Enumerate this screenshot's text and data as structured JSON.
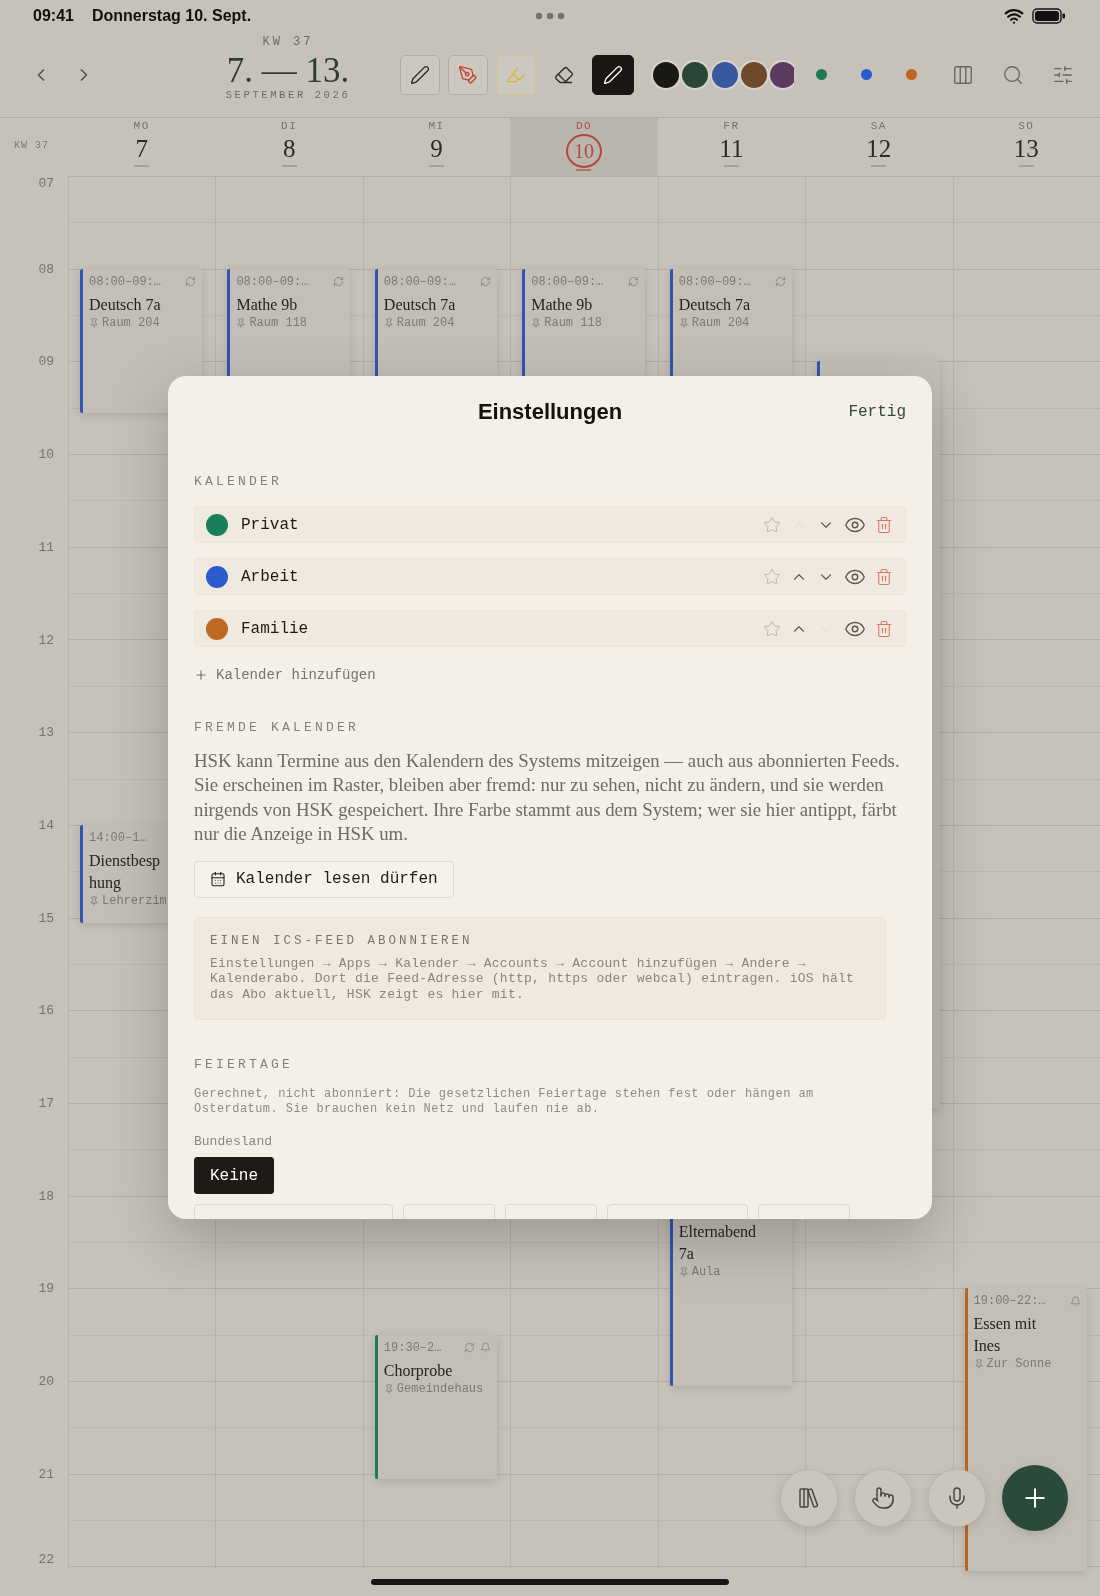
{
  "status_bar": {
    "time": "09:41",
    "date": "Donnerstag 10. Sept."
  },
  "toolbar": {
    "week": "KW 37",
    "range": "7. — 13.",
    "month": "SEPTEMBER 2026",
    "tools": [
      {
        "kind": "pen",
        "selected": false
      },
      {
        "kind": "marker",
        "selected": false
      },
      {
        "kind": "highlighter",
        "selected": false
      },
      {
        "kind": "eraser",
        "selected": false
      },
      {
        "kind": "pen",
        "selected": true
      }
    ],
    "swatches": [
      {
        "color": "#1b1917"
      },
      {
        "color": "#2b4537"
      },
      {
        "color": "#3a58a0"
      },
      {
        "color": "#6e4a2d"
      },
      {
        "color": "#5b3a60"
      }
    ],
    "calendar_dots": [
      {
        "color": "#1d7a55"
      },
      {
        "color": "#2c5bd0"
      },
      {
        "color": "#c0661f"
      }
    ]
  },
  "week_label": "KW 37",
  "days": [
    {
      "name": "MO",
      "number": "7",
      "selected": false,
      "events": [
        {
          "kind": "lesson",
          "time": "08:00–09:…",
          "title": "Deutsch 7a",
          "location": "Raum 204",
          "color": "#2f57b0",
          "recurring": true,
          "reminder": false
        },
        {
          "kind": "meeting",
          "time": "14:00–1…",
          "title": "Dienstbesp hung",
          "location": "Lehrerzim",
          "color": "#2f57b0",
          "recurring": false,
          "reminder": false
        }
      ]
    },
    {
      "name": "DI",
      "number": "8",
      "selected": false,
      "events": [
        {
          "kind": "lesson",
          "time": "08:00–09:…",
          "title": "Mathe 9b",
          "location": "Raum 118",
          "color": "#2f57b0",
          "recurring": true,
          "reminder": false
        }
      ]
    },
    {
      "name": "MI",
      "number": "9",
      "selected": false,
      "events": [
        {
          "kind": "lesson",
          "time": "08:00–09:…",
          "title": "Deutsch 7a",
          "location": "Raum 204",
          "color": "#2f57b0",
          "recurring": true,
          "reminder": false
        },
        {
          "kind": "rehearsal",
          "time": "19:30–2…",
          "title": "Chorprobe",
          "location": "Gemeindehaus",
          "color": "#1f7a52",
          "recurring": true,
          "reminder": true
        }
      ]
    },
    {
      "name": "DO",
      "number": "10",
      "selected": true,
      "events": [
        {
          "kind": "lesson",
          "time": "08:00–09:…",
          "title": "Mathe 9b",
          "location": "Raum 118",
          "color": "#2f57b0",
          "recurring": true,
          "reminder": false
        }
      ]
    },
    {
      "name": "FR",
      "number": "11",
      "selected": false,
      "events": [
        {
          "kind": "lesson",
          "time": "08:00–09:…",
          "title": "Deutsch 7a",
          "location": "Raum 204",
          "color": "#2f57b0",
          "recurring": true,
          "reminder": false
        },
        {
          "kind": "parents",
          "title": "Elternabend 7a",
          "location": "Aula",
          "color": "#2f57b0"
        }
      ]
    },
    {
      "name": "SA",
      "number": "12",
      "selected": false,
      "events": [
        {
          "kind": "workday",
          "color": "#2f57b0"
        }
      ]
    },
    {
      "name": "SO",
      "number": "13",
      "selected": false,
      "events": [
        {
          "kind": "dinner",
          "time": "19:00–22:…",
          "title": "Essen mit Ines",
          "location": "Zur Sonne",
          "color": "#b8651f",
          "recurring": false,
          "reminder": true
        }
      ]
    }
  ],
  "hours": [
    "07",
    "08",
    "09",
    "10",
    "11",
    "12",
    "13",
    "14",
    "15",
    "16",
    "17",
    "18",
    "19",
    "20",
    "21",
    "22"
  ],
  "settings": {
    "title": "Einstellungen",
    "done": "Fertig",
    "calendars_heading": "KALENDER",
    "calendars": [
      {
        "name": "Privat",
        "color": "#1a7f5a",
        "favorite": false,
        "visible": true,
        "up_disabled": true,
        "down_disabled": false
      },
      {
        "name": "Arbeit",
        "color": "#2c5bd0",
        "favorite": false,
        "visible": true,
        "up_disabled": false,
        "down_disabled": false
      },
      {
        "name": "Familie",
        "color": "#bf6a22",
        "favorite": false,
        "visible": true,
        "up_disabled": false,
        "down_disabled": true
      }
    ],
    "add_calendar": "Kalender hinzufügen",
    "external_heading": "FREMDE KALENDER",
    "external_text": "HSK kann Termine aus den Kalendern des Systems mitzeigen — auch aus abonnierten Feeds. Sie erscheinen im Raster, bleiben aber fremd: nur zu sehen, nicht zu ändern, und sie werden nirgends von HSK gespeichert. Ihre Farbe stammt aus dem System; wer sie hier antippt, färbt nur die Anzeige in HSK um.",
    "permission_button": "Kalender lesen dürfen",
    "ics": {
      "heading": "EINEN ICS-FEED ABONNIEREN",
      "text": "Einstellungen → Apps → Kalender → Accounts → Account hinzufügen → Andere → Kalenderabo. Dort die Feed-Adresse (http, https oder webcal) eintragen. iOS hält das Abo aktuell, HSK zeigt es hier mit."
    },
    "holidays_heading": "FEIERTAGE",
    "holidays_note": "Gerechnet, nicht abonniert: Die gesetzlichen Feiertage stehen fest oder hängen am Osterdatum. Sie brauchen kein Netz und laufen nie ab.",
    "state_label": "Bundesland",
    "states": [
      {
        "label": "Keine",
        "selected": true
      }
    ],
    "more_states": [
      {
        "kind": "wide"
      },
      {
        "kind": "narrow"
      },
      {
        "kind": "narrow"
      },
      {
        "kind": "medium"
      },
      {
        "kind": "narrow"
      }
    ]
  }
}
